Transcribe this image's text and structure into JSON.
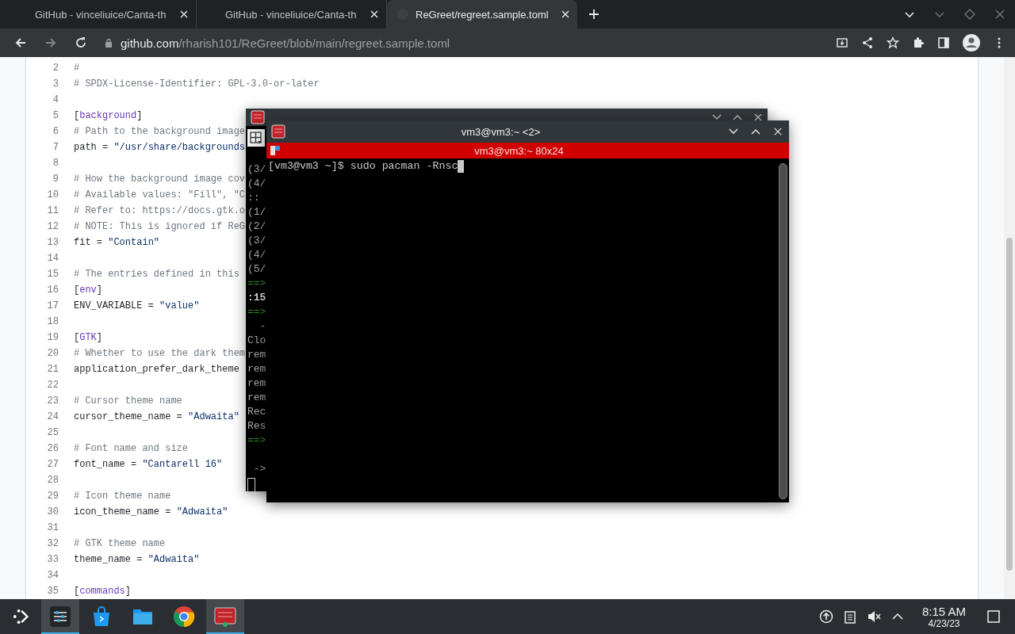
{
  "browser": {
    "tabs": [
      {
        "title": "GitHub - vinceliuice/Canta-th",
        "selected": false
      },
      {
        "title": "GitHub - vinceliuice/Canta-th",
        "selected": false
      },
      {
        "title": "ReGreet/regreet.sample.toml",
        "selected": true
      }
    ],
    "address": {
      "host": "github.com",
      "path": "/rharish101/ReGreet/blob/main/regreet.sample.toml"
    }
  },
  "code": {
    "lines": [
      {
        "number": "2",
        "parts": [
          {
            "kind": "comment",
            "text": "#"
          }
        ]
      },
      {
        "number": "3",
        "parts": [
          {
            "kind": "comment",
            "text": "# SPDX-License-Identifier: GPL-3.0-or-later"
          }
        ]
      },
      {
        "number": "4"
      },
      {
        "number": "5",
        "parts": [
          {
            "kind": "plain",
            "text": "["
          },
          {
            "kind": "section",
            "text": "background"
          },
          {
            "kind": "plain",
            "text": "]"
          }
        ]
      },
      {
        "number": "6",
        "parts": [
          {
            "kind": "comment",
            "text": "# Path to the background image"
          }
        ]
      },
      {
        "number": "7",
        "parts": [
          {
            "kind": "plain",
            "text": "path = "
          },
          {
            "kind": "string",
            "text": "\"/usr/share/backgrounds"
          }
        ]
      },
      {
        "number": "8"
      },
      {
        "number": "9",
        "parts": [
          {
            "kind": "comment",
            "text": "# How the background image cov"
          }
        ]
      },
      {
        "number": "10",
        "parts": [
          {
            "kind": "comment",
            "text": "# Available values: \"Fill\", \"C"
          }
        ]
      },
      {
        "number": "11",
        "parts": [
          {
            "kind": "comment",
            "text": "# Refer to: https://docs.gtk.o"
          }
        ]
      },
      {
        "number": "12",
        "parts": [
          {
            "kind": "comment",
            "text": "# NOTE: This is ignored if ReG"
          }
        ]
      },
      {
        "number": "13",
        "parts": [
          {
            "kind": "plain",
            "text": "fit = "
          },
          {
            "kind": "string",
            "text": "\"Contain\""
          }
        ]
      },
      {
        "number": "14"
      },
      {
        "number": "15",
        "parts": [
          {
            "kind": "comment",
            "text": "# The entries defined in this"
          }
        ]
      },
      {
        "number": "16",
        "parts": [
          {
            "kind": "plain",
            "text": "["
          },
          {
            "kind": "section",
            "text": "env"
          },
          {
            "kind": "plain",
            "text": "]"
          }
        ]
      },
      {
        "number": "17",
        "parts": [
          {
            "kind": "plain",
            "text": "ENV_VARIABLE = "
          },
          {
            "kind": "string",
            "text": "\"value\""
          }
        ]
      },
      {
        "number": "18"
      },
      {
        "number": "19",
        "parts": [
          {
            "kind": "plain",
            "text": "["
          },
          {
            "kind": "section",
            "text": "GTK"
          },
          {
            "kind": "plain",
            "text": "]"
          }
        ]
      },
      {
        "number": "20",
        "parts": [
          {
            "kind": "comment",
            "text": "# Whether to use the dark them"
          }
        ]
      },
      {
        "number": "21",
        "parts": [
          {
            "kind": "plain",
            "text": "application_prefer_dark_theme"
          }
        ]
      },
      {
        "number": "22"
      },
      {
        "number": "23",
        "parts": [
          {
            "kind": "comment",
            "text": "# Cursor theme name"
          }
        ]
      },
      {
        "number": "24",
        "parts": [
          {
            "kind": "plain",
            "text": "cursor_theme_name = "
          },
          {
            "kind": "string",
            "text": "\"Adwaita\""
          }
        ]
      },
      {
        "number": "25"
      },
      {
        "number": "26",
        "parts": [
          {
            "kind": "comment",
            "text": "# Font name and size"
          }
        ]
      },
      {
        "number": "27",
        "parts": [
          {
            "kind": "plain",
            "text": "font_name = "
          },
          {
            "kind": "string",
            "text": "\"Cantarell 16\""
          }
        ]
      },
      {
        "number": "28"
      },
      {
        "number": "29",
        "parts": [
          {
            "kind": "comment",
            "text": "# Icon theme name"
          }
        ]
      },
      {
        "number": "30",
        "parts": [
          {
            "kind": "plain",
            "text": "icon_theme_name = "
          },
          {
            "kind": "string",
            "text": "\"Adwaita\""
          }
        ]
      },
      {
        "number": "31"
      },
      {
        "number": "32",
        "parts": [
          {
            "kind": "comment",
            "text": "# GTK theme name"
          }
        ]
      },
      {
        "number": "33",
        "parts": [
          {
            "kind": "plain",
            "text": "theme_name = "
          },
          {
            "kind": "string",
            "text": "\"Adwaita\""
          }
        ]
      },
      {
        "number": "34"
      },
      {
        "number": "35",
        "parts": [
          {
            "kind": "plain",
            "text": "["
          },
          {
            "kind": "section",
            "text": "commands"
          },
          {
            "kind": "plain",
            "text": "]"
          }
        ]
      }
    ]
  },
  "terminal_back": {
    "lines": [
      {
        "kind": "plain",
        "text": "(3/"
      },
      {
        "kind": "plain",
        "text": "(4/"
      },
      {
        "kind": "plain",
        "text": "::"
      },
      {
        "kind": "plain",
        "text": "(1/"
      },
      {
        "kind": "plain",
        "text": "(2/"
      },
      {
        "kind": "plain",
        "text": "(3/"
      },
      {
        "kind": "plain",
        "text": "(4/"
      },
      {
        "kind": "plain",
        "text": "(5/"
      },
      {
        "kind": "arrow",
        "text": "==>"
      },
      {
        "kind": "bold",
        "text": ":15"
      },
      {
        "kind": "arrow",
        "text": "==>"
      },
      {
        "kind": "plain",
        "text": "  -"
      },
      {
        "kind": "plain",
        "text": "Clo"
      },
      {
        "kind": "plain",
        "text": "rem"
      },
      {
        "kind": "plain",
        "text": "rem"
      },
      {
        "kind": "plain",
        "text": "rem"
      },
      {
        "kind": "plain",
        "text": "rem"
      },
      {
        "kind": "plain",
        "text": "Rec"
      },
      {
        "kind": "plain",
        "text": "Res"
      },
      {
        "kind": "arrow",
        "text": "==>"
      },
      {
        "kind": "blank"
      },
      {
        "kind": "plain",
        "text": " ->"
      }
    ]
  },
  "terminal": {
    "title": "vm3@vm3:~ <2>",
    "tab_title": "vm3@vm3:~ 80x24",
    "prompt": "[vm3@vm3 ~]$ sudo pacman -Rnsc"
  },
  "taskbar": {
    "apps": [
      {
        "kind": "settings",
        "active": true
      },
      {
        "kind": "store",
        "active": false
      },
      {
        "kind": "files",
        "active": false
      },
      {
        "kind": "browser",
        "active": false
      },
      {
        "kind": "terminal",
        "active": true
      }
    ],
    "time": "8:15 AM",
    "date": "4/23/23"
  }
}
